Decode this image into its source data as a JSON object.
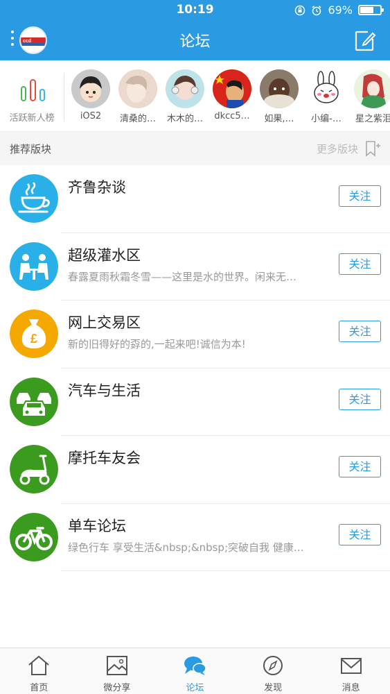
{
  "status_bar": {
    "time": "10:19",
    "battery": "69%",
    "battery_level": 0.69
  },
  "nav": {
    "title": "论坛"
  },
  "active_users": {
    "label": "活跃新人榜",
    "users": [
      {
        "name": "iOS2"
      },
      {
        "name": "清桑的…"
      },
      {
        "name": "木木的…"
      },
      {
        "name": "dkcc5…"
      },
      {
        "name": "如果,…"
      },
      {
        "name": "小编-…"
      },
      {
        "name": "星之紫泪"
      }
    ]
  },
  "section": {
    "title": "推荐版块",
    "more": "更多版块"
  },
  "forums": [
    {
      "name": "齐鲁杂谈",
      "desc": "",
      "follow": "关注",
      "icon": "coffee-cup-icon",
      "color": "#2ab0e8"
    },
    {
      "name": "超级灌水区",
      "desc": "春露夏雨秋霜冬雪——这里是水的世界。闲来无…",
      "follow": "关注",
      "icon": "people-chat-icon",
      "color": "#2ab0e8"
    },
    {
      "name": "网上交易区",
      "desc": "新的旧得好的孬的,一起来吧!诚信为本!",
      "follow": "关注",
      "icon": "money-bag-icon",
      "color": "#f5a800"
    },
    {
      "name": "汽车与生活",
      "desc": "",
      "follow": "关注",
      "icon": "cars-icon",
      "color": "#3a9b1e"
    },
    {
      "name": "摩托车友会",
      "desc": "",
      "follow": "关注",
      "icon": "scooter-icon",
      "color": "#3a9b1e"
    },
    {
      "name": "单车论坛",
      "desc": "绿色行车 享受生活&nbsp;&nbsp;突破自我 健康…",
      "follow": "关注",
      "icon": "bicycle-icon",
      "color": "#3a9b1e"
    }
  ],
  "tabs": [
    {
      "label": "首页",
      "icon": "home-icon"
    },
    {
      "label": "微分享",
      "icon": "image-icon"
    },
    {
      "label": "论坛",
      "icon": "chat-bubbles-icon",
      "active": true
    },
    {
      "label": "发现",
      "icon": "compass-icon"
    },
    {
      "label": "消息",
      "icon": "mail-icon"
    }
  ],
  "colors": {
    "primary": "#2a9be3"
  }
}
